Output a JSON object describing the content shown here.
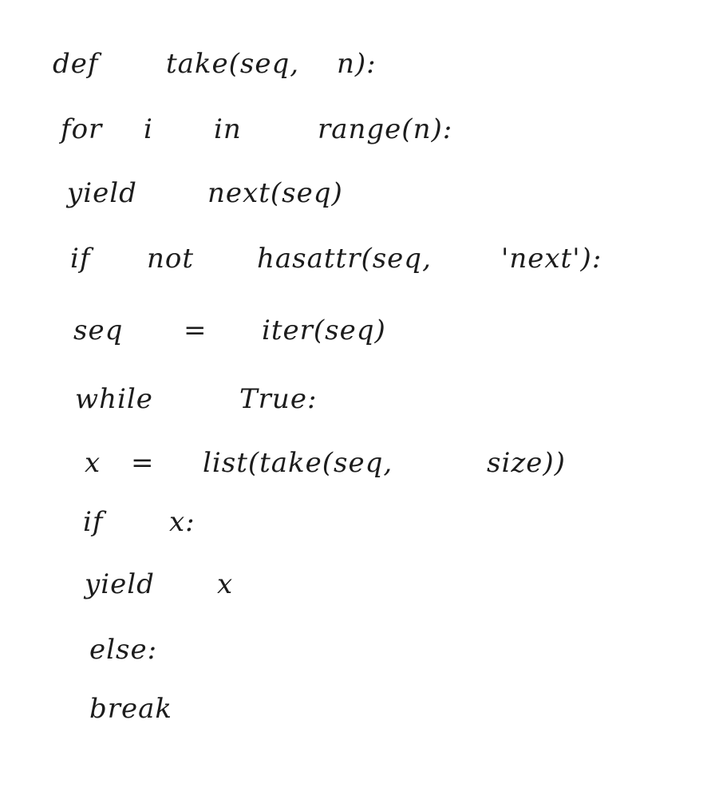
{
  "handwritten_code": {
    "lines": [
      [
        "def",
        "take(seq,",
        "n):"
      ],
      [
        "for",
        "i",
        "in",
        "range(n):"
      ],
      [
        "yield",
        "next(seq)"
      ],
      [
        "if",
        "not",
        "hasattr(seq,",
        "'next'):"
      ],
      [
        "seq",
        "=",
        "iter(seq)"
      ],
      [
        "while",
        "True:"
      ],
      [
        "x",
        "=",
        "list(take(seq,",
        "size))"
      ],
      [
        "if",
        "x:"
      ],
      [
        "yield",
        "x"
      ],
      [
        "else:"
      ],
      [
        "break"
      ]
    ]
  },
  "colors": {
    "ink": "#1c1c1c",
    "paper": "#ffffff"
  }
}
